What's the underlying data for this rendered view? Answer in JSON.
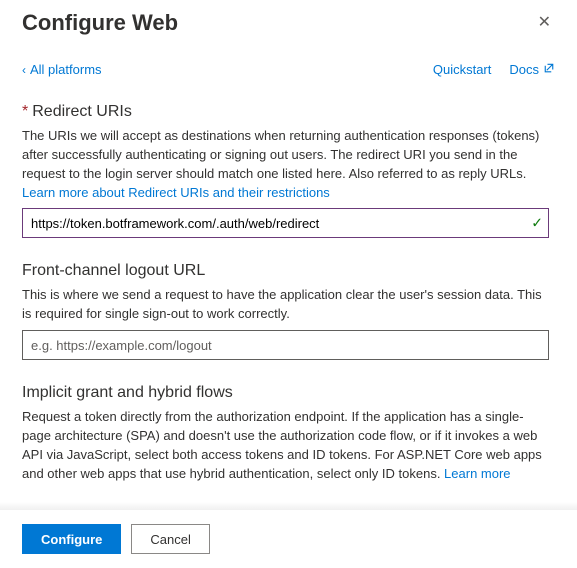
{
  "header": {
    "title": "Configure Web",
    "close_label": "✕"
  },
  "topbar": {
    "back_label": "All platforms",
    "quickstart_label": "Quickstart",
    "docs_label": "Docs"
  },
  "sections": {
    "redirect": {
      "title": "Redirect URIs",
      "desc": "The URIs we will accept as destinations when returning authentication responses (tokens) after successfully authenticating or signing out users. The redirect URI you send in the request to the login server should match one listed here. Also referred to as reply URLs.",
      "learn_more": "Learn more about Redirect URIs and their restrictions",
      "value": "https://token.botframework.com/.auth/web/redirect"
    },
    "logout": {
      "title": "Front-channel logout URL",
      "desc": "This is where we send a request to have the application clear the user's session data. This is required for single sign-out to work correctly.",
      "placeholder": "e.g. https://example.com/logout",
      "value": ""
    },
    "implicit": {
      "title": "Implicit grant and hybrid flows",
      "desc": "Request a token directly from the authorization endpoint. If the application has a single-page architecture (SPA) and doesn't use the authorization code flow, or if it invokes a web API via JavaScript, select both access tokens and ID tokens. For ASP.NET Core web apps and other web apps that use hybrid authentication, select only ID tokens. ",
      "learn_more": "Learn more"
    }
  },
  "footer": {
    "configure_label": "Configure",
    "cancel_label": "Cancel"
  }
}
